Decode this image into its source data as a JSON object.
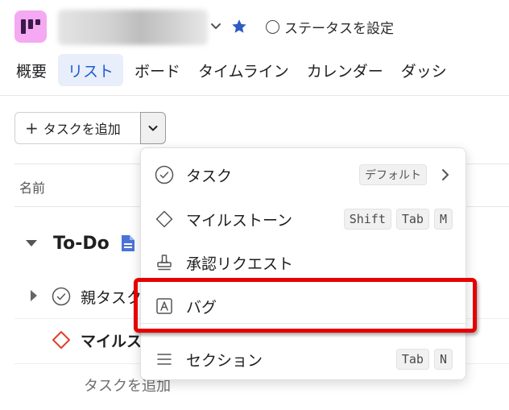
{
  "header": {
    "status_label": "ステータスを設定"
  },
  "tabs": [
    {
      "label": "概要"
    },
    {
      "label": "リスト"
    },
    {
      "label": "ボード"
    },
    {
      "label": "タイムライン"
    },
    {
      "label": "カレンダー"
    },
    {
      "label": "ダッシ"
    }
  ],
  "toolbar": {
    "add_task_label": "タスクを追加"
  },
  "list": {
    "column_name": "名前",
    "section_title": "To-Do",
    "rows": [
      {
        "text": "親タスク"
      },
      {
        "text": "マイルス"
      }
    ],
    "add_task_label": "タスクを追加"
  },
  "menu": {
    "items": [
      {
        "label": "タスク",
        "badge": "デフォルト"
      },
      {
        "label": "マイルストーン",
        "shortcut": [
          "Shift",
          "Tab",
          "M"
        ]
      },
      {
        "label": "承認リクエスト"
      },
      {
        "label": "バグ"
      },
      {
        "label": "セクション",
        "shortcut": [
          "Tab",
          "N"
        ]
      }
    ]
  },
  "colors": {
    "accent": "#1f5bd6",
    "project_icon_bg": "#f4a9f2",
    "milestone_red": "#e2412c",
    "highlight_red": "#e60000"
  }
}
